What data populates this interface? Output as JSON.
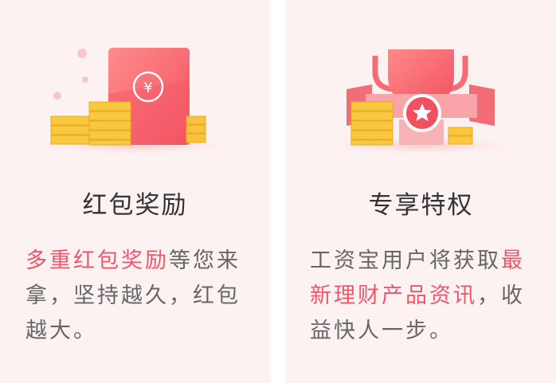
{
  "cards": [
    {
      "title": "红包奖励",
      "desc_highlight": "多重红包奖励",
      "desc_rest": "等您来拿，坚持越久，红包越大。",
      "icon": "red-envelope-icon",
      "envelope_symbol": "¥"
    },
    {
      "title": "专享特权",
      "desc_lead": "工资宝用户将获取",
      "desc_highlight": "最新理财产品资讯",
      "desc_rest": "，收益快人一步。",
      "icon": "trophy-icon"
    }
  ],
  "colors": {
    "card_bg": "#fdf2f2",
    "highlight": "#f0566b",
    "title": "#333333",
    "body_text": "#666666"
  }
}
